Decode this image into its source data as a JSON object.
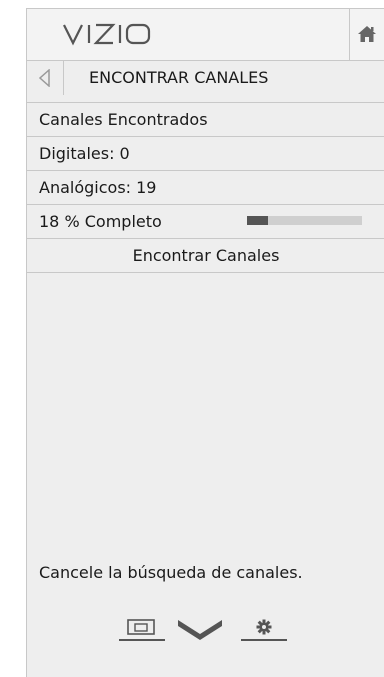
{
  "header": {
    "logo_text": "VIZIO",
    "home_icon": "home-icon"
  },
  "title_bar": {
    "back_icon": "back-arrow-icon",
    "title": "ENCONTRAR CANALES"
  },
  "items": {
    "found_label": "Canales Encontrados",
    "digital": "Digitales: 0",
    "analog": "Analógicos: 19",
    "progress_text": "18 % Completo",
    "progress_percent": 18,
    "action": "Encontrar Canales"
  },
  "hint": "Cancele la búsqueda de canales.",
  "bottom_nav": {
    "icons": [
      "picture-input-icon",
      "vizio-chevron-icon",
      "settings-gear-icon"
    ]
  },
  "colors": {
    "panel_bg": "#eeeeee",
    "progress_fill": "#555555",
    "progress_track": "#cfcfcf"
  }
}
